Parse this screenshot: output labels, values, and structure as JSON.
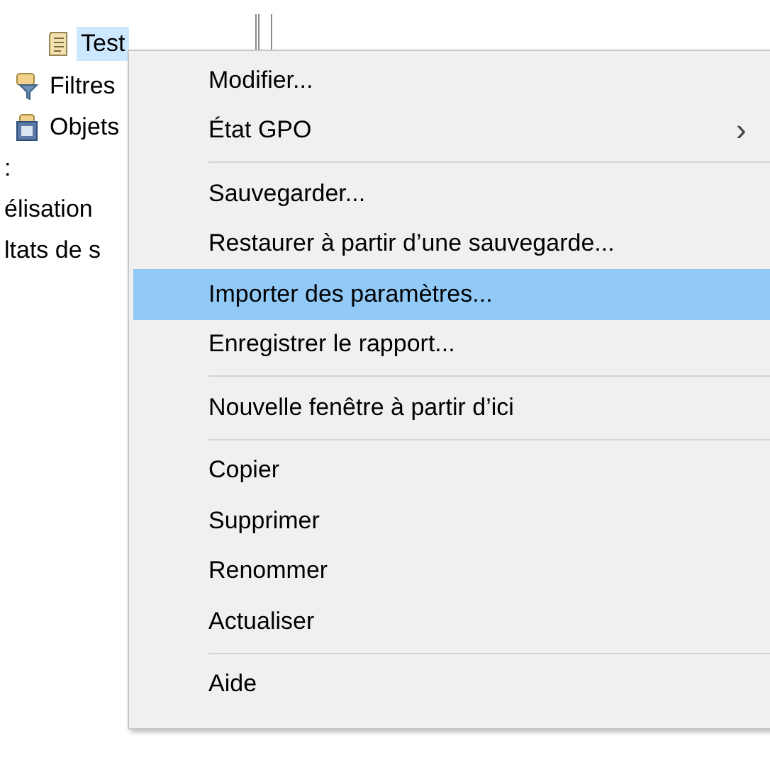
{
  "tree": [
    {
      "kind": "scroll",
      "label": "Test",
      "selected": true
    },
    {
      "kind": "filter",
      "label": "Filtres",
      "selected": false
    },
    {
      "kind": "objects",
      "label": "Objets",
      "selected": false
    },
    {
      "kind": "text",
      "label": ":",
      "selected": false
    },
    {
      "kind": "text",
      "label": "élisation",
      "selected": false
    },
    {
      "kind": "text",
      "label": "ltats de s",
      "selected": false
    }
  ],
  "context_menu": {
    "items": [
      {
        "kind": "item",
        "label": "Modifier...",
        "selected": false
      },
      {
        "kind": "item",
        "label": "État GPO",
        "selected": false,
        "submenu_arrow": "›"
      },
      {
        "kind": "separator"
      },
      {
        "kind": "item",
        "label": "Sauvegarder...",
        "selected": false
      },
      {
        "kind": "item",
        "label": "Restaurer à partir d’une sauvegarde...",
        "selected": false
      },
      {
        "kind": "item",
        "label": "Importer des paramètres...",
        "selected": true
      },
      {
        "kind": "item",
        "label": "Enregistrer le rapport...",
        "selected": false
      },
      {
        "kind": "separator"
      },
      {
        "kind": "item",
        "label": "Nouvelle fenêtre à partir d’ici",
        "selected": false
      },
      {
        "kind": "separator"
      },
      {
        "kind": "item",
        "label": "Copier",
        "selected": false
      },
      {
        "kind": "item",
        "label": "Supprimer",
        "selected": false
      },
      {
        "kind": "item",
        "label": "Renommer",
        "selected": false
      },
      {
        "kind": "item",
        "label": "Actualiser",
        "selected": false
      },
      {
        "kind": "separator"
      },
      {
        "kind": "item",
        "label": "Aide",
        "selected": false
      }
    ]
  }
}
